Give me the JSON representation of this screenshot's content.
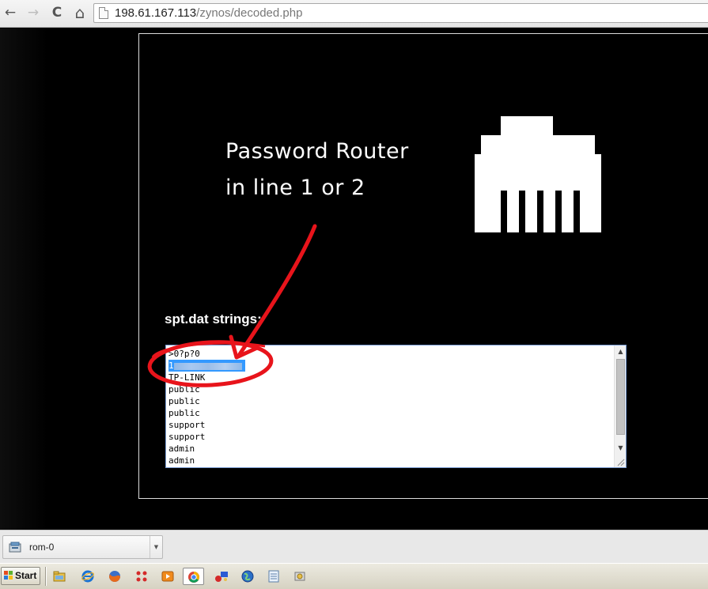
{
  "browser": {
    "url_host": "198.61.167.113",
    "url_path": "/zynos/decoded.php",
    "nav": {
      "back_icon": "←",
      "forward_icon": "→",
      "reload_icon": "C",
      "home_icon": "⌂"
    }
  },
  "annotation": {
    "line1": "Password Router",
    "line2": "in line 1 or 2",
    "color": "#e8141b"
  },
  "section_label": "spt.dat strings:",
  "strings_list": {
    "items": [
      {
        "text": ">0?p?0",
        "selected": false
      },
      {
        "text": "1",
        "selected": true,
        "redacted": true
      },
      {
        "text": "TP-LINK",
        "selected": false
      },
      {
        "text": "public",
        "selected": false
      },
      {
        "text": "public",
        "selected": false
      },
      {
        "text": "public",
        "selected": false
      },
      {
        "text": "support",
        "selected": false
      },
      {
        "text": "support",
        "selected": false
      },
      {
        "text": "admin",
        "selected": false
      },
      {
        "text": "admin",
        "selected": false
      }
    ]
  },
  "download_bar": {
    "file_name": "rom-0",
    "menu_icon": "▼"
  },
  "taskbar": {
    "start_label": "Start",
    "icons": [
      "explorer-icon",
      "ie-icon",
      "firefox-icon",
      "app-grid-icon",
      "media-player-icon",
      "chrome-icon",
      "network-icon",
      "globe-icon",
      "notepad-icon",
      "tool-icon"
    ]
  }
}
